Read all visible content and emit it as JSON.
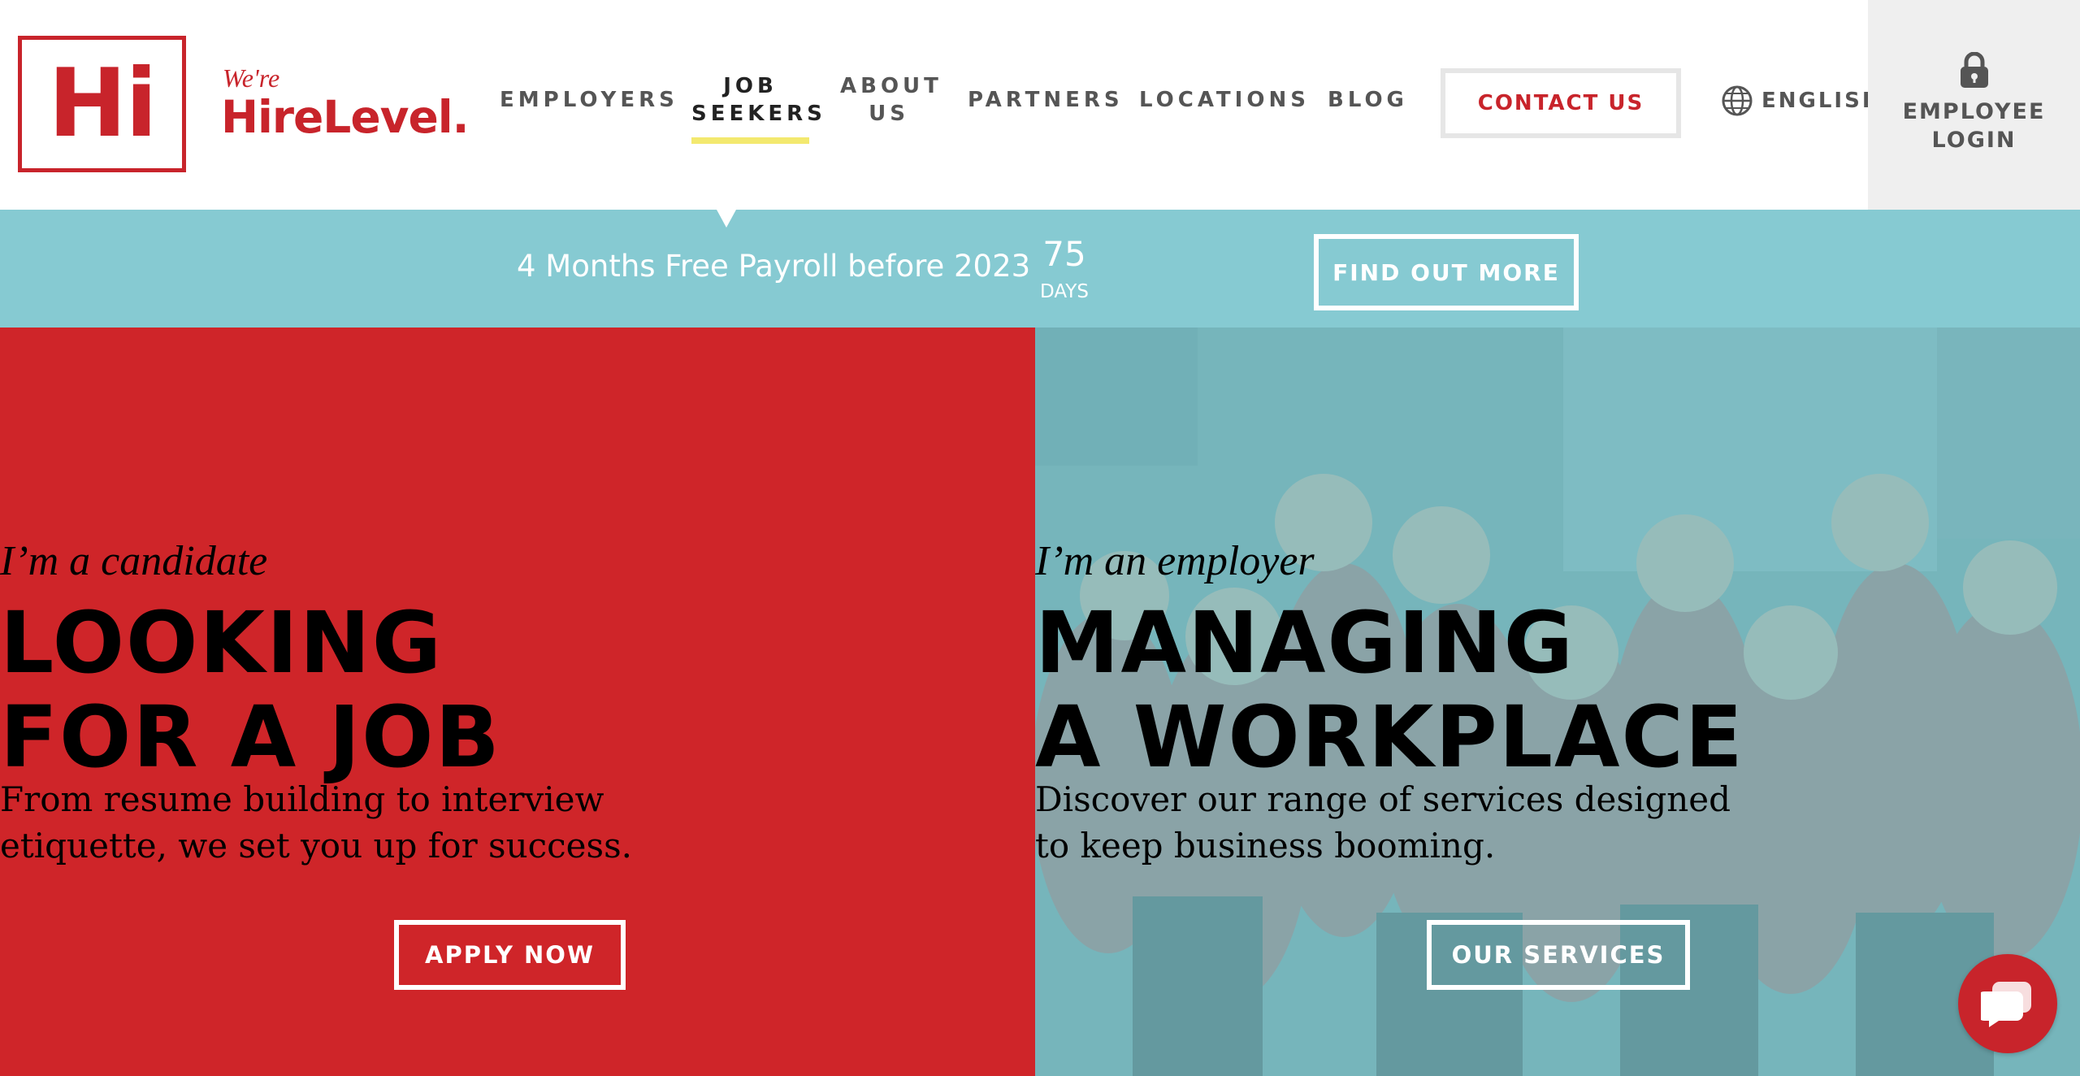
{
  "brand": {
    "logo_mark": "Hi",
    "tagline": "We're",
    "name": "HireLevel."
  },
  "nav": {
    "items": [
      {
        "label": "EMPLOYERS"
      },
      {
        "line1": "JOB",
        "line2": "SEEKERS",
        "active": true
      },
      {
        "line1": "ABOUT",
        "line2": "US"
      },
      {
        "label": "PARTNERS"
      },
      {
        "label": "LOCATIONS"
      },
      {
        "label": "BLOG"
      }
    ],
    "contact_label": "CONTACT US",
    "language": {
      "label": "ENGLISH",
      "icon": "globe-icon"
    },
    "login": {
      "line1": "EMPLOYEE",
      "line2": "LOGIN",
      "icon": "lock-icon"
    }
  },
  "promo": {
    "text": "4 Months Free Payroll before 2023",
    "countdown_value": "75",
    "countdown_unit": "DAYS",
    "button_label": "FIND OUT MORE"
  },
  "hero": {
    "candidate": {
      "kicker": "I’m a candidate",
      "headline_line1": "LOOKING",
      "headline_line2": "FOR A JOB",
      "sub_line1": "From resume building to interview",
      "sub_line2": "etiquette, we set you up for success.",
      "button_label": "APPLY NOW"
    },
    "employer": {
      "kicker": "I’m an employer",
      "headline_line1": "MANAGING",
      "headline_line2": "A WORKPLACE",
      "sub_line1": "Discover our range of services designed",
      "sub_line2": "to keep business booming.",
      "button_label": "OUR SERVICES"
    }
  },
  "chat": {
    "icon": "chat-bubble-icon"
  },
  "colors": {
    "brand_red": "#c8242b",
    "promo_teal": "#86cad2",
    "hero_red": "#cf2529",
    "photo_tint": "#7fb2b7",
    "active_underline": "#f3e96f"
  }
}
